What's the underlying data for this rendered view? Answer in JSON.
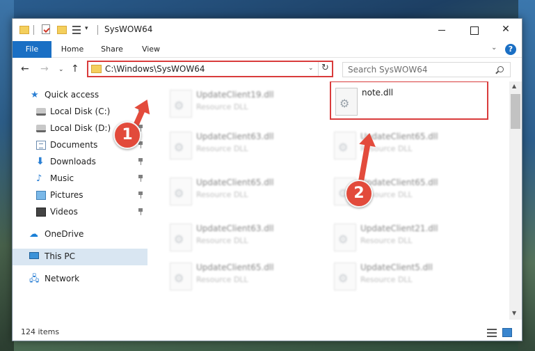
{
  "window": {
    "title": "SysWOW64",
    "min_label": "",
    "max_label": "",
    "close_label": "✕"
  },
  "ribbon": {
    "tabs": [
      "File",
      "Home",
      "Share",
      "View"
    ],
    "chevron": "⌄",
    "help": "?"
  },
  "nav": {
    "back": "←",
    "forward": "→",
    "recent": "⌄",
    "up": "↑",
    "address": "C:\\Windows\\SysWOW64",
    "address_dropdown": "⌄",
    "refresh": "↻",
    "search_placeholder": "Search SysWOW64"
  },
  "sidebar": {
    "items": [
      {
        "label": "Quick access",
        "icon": "star-icon"
      },
      {
        "label": "Local Disk (C:)",
        "icon": "disk-icon"
      },
      {
        "label": "Local Disk (D:)",
        "icon": "disk-icon"
      },
      {
        "label": "Documents",
        "icon": "documents-icon"
      },
      {
        "label": "Downloads",
        "icon": "download-icon"
      },
      {
        "label": "Music",
        "icon": "music-icon"
      },
      {
        "label": "Pictures",
        "icon": "pictures-icon"
      },
      {
        "label": "Videos",
        "icon": "videos-icon"
      },
      {
        "label": "OneDrive",
        "icon": "cloud-icon"
      },
      {
        "label": "This PC",
        "icon": "computer-icon"
      },
      {
        "label": "Network",
        "icon": "network-icon"
      }
    ]
  },
  "files": {
    "left": [
      {
        "name": "UpdateClient19.dll",
        "type": "Resource DLL"
      },
      {
        "name": "UpdateClient63.dll",
        "type": "Resource DLL"
      },
      {
        "name": "UpdateClient65.dll",
        "type": "Resource DLL"
      },
      {
        "name": "UpdateClient63.dll",
        "type": "Resource DLL"
      },
      {
        "name": "UpdateClient65.dll",
        "type": "Resource DLL"
      }
    ],
    "right": [
      {
        "name": "note.dll",
        "type": ""
      },
      {
        "name": "UpdateClient65.dll",
        "type": "Resource DLL"
      },
      {
        "name": "UpdateClient65.dll",
        "type": "Resource DLL"
      },
      {
        "name": "UpdateClient21.dll",
        "type": "Resource DLL"
      },
      {
        "name": "UpdateClient5.dll",
        "type": "Resource DLL"
      }
    ]
  },
  "status": {
    "items": "124 items"
  },
  "annotations": {
    "badge1": "1",
    "badge2": "2"
  },
  "colors": {
    "accent": "#1a6fc4",
    "highlight": "#d93b3b",
    "annotation": "#e34b3c"
  }
}
